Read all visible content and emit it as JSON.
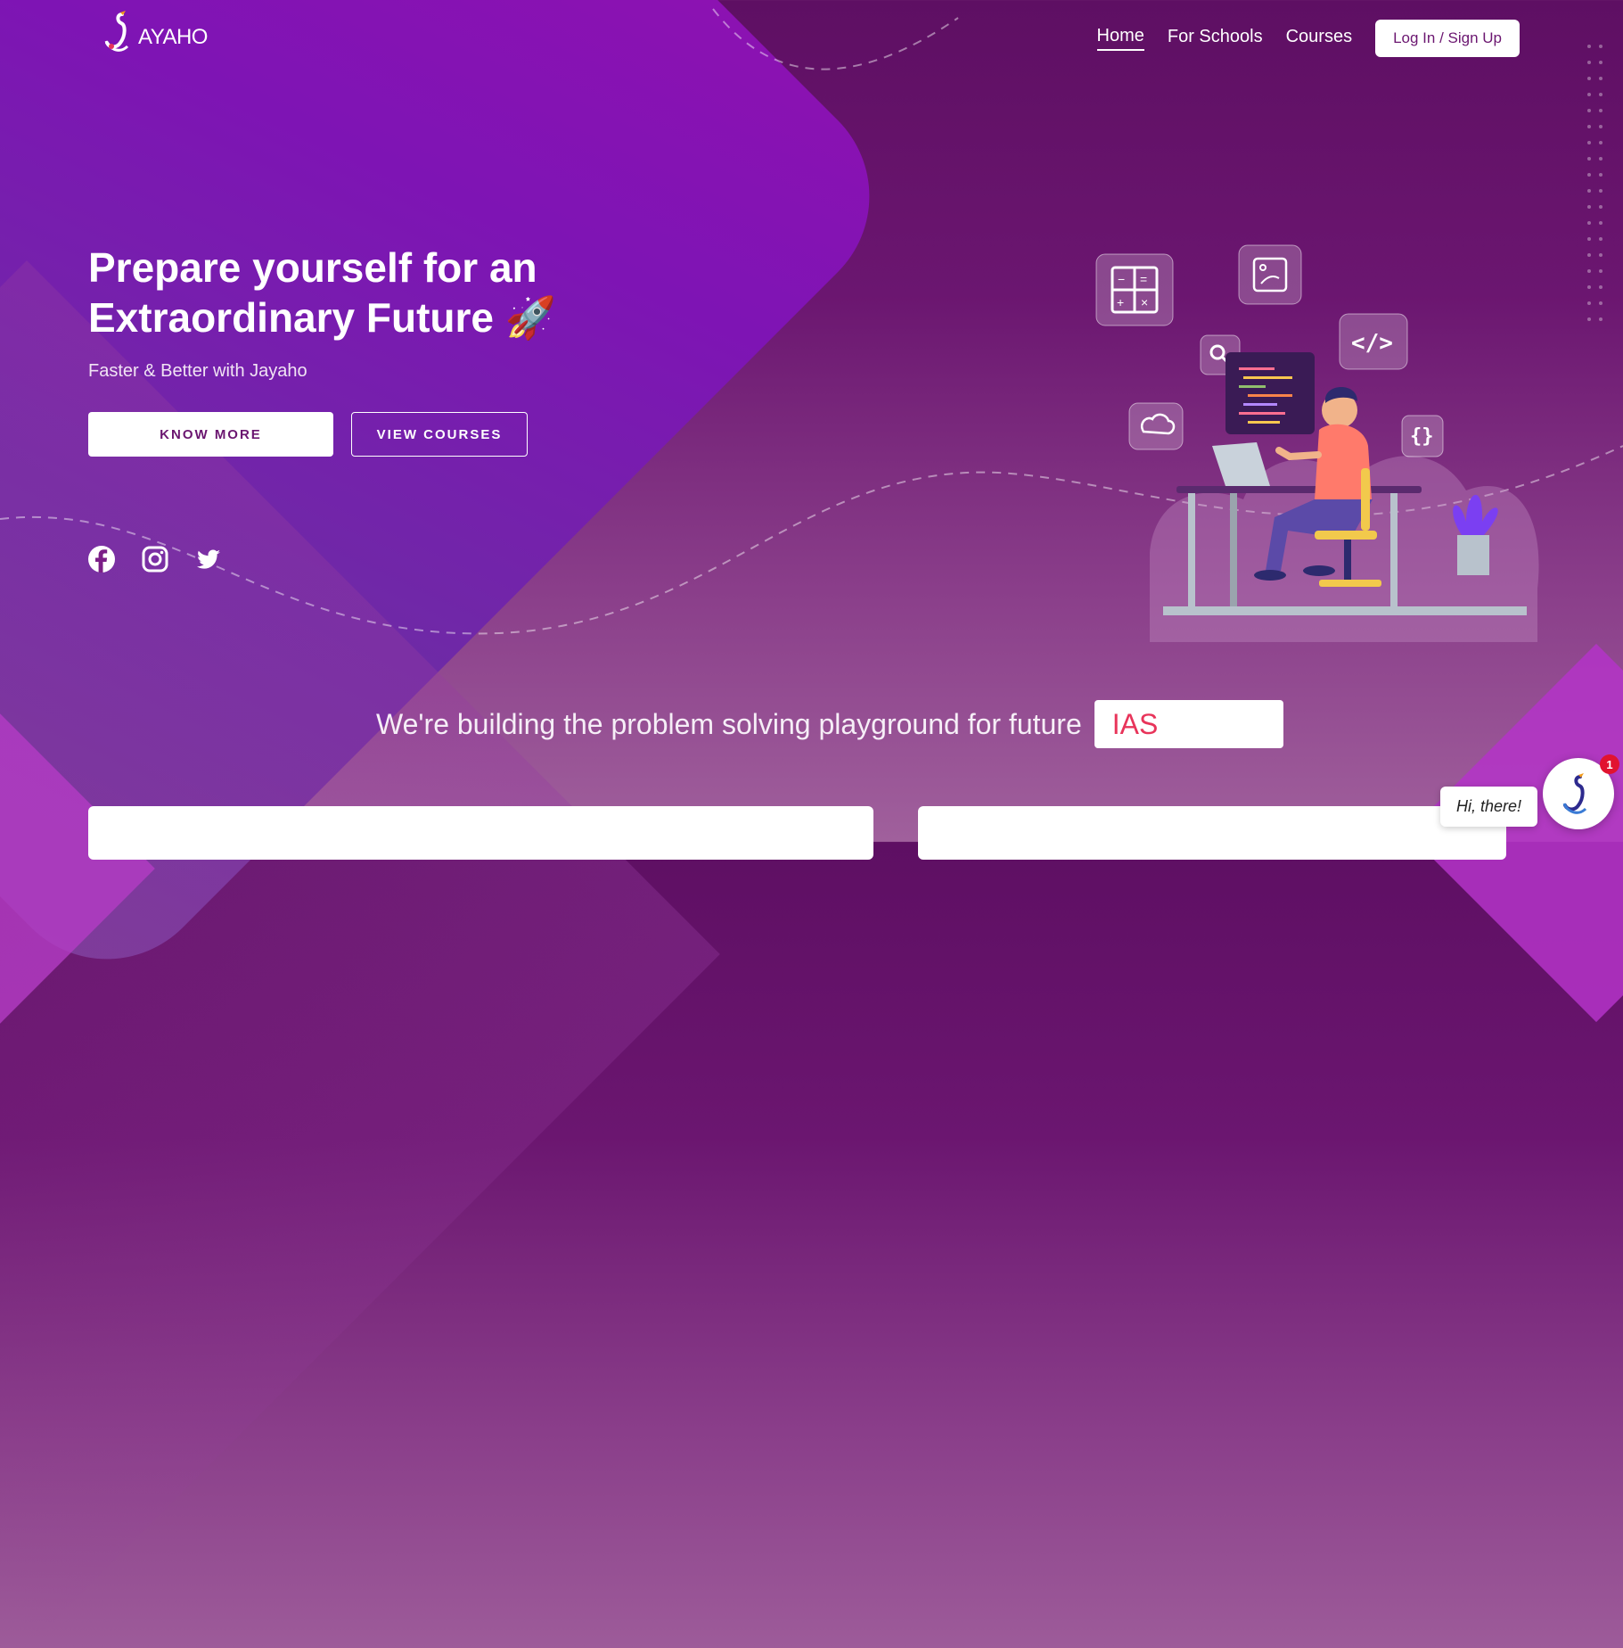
{
  "brand": {
    "logo_text": "AYAHO",
    "accent": "#6b1670",
    "highlight": "#e8345a"
  },
  "nav": {
    "links": [
      "Home",
      "For Schools",
      "Courses"
    ],
    "active": "Home",
    "login_label": "Log In / Sign Up"
  },
  "hero": {
    "title_line1": "Prepare yourself for an",
    "title_line2": "Extraordinary Future 🚀",
    "subtitle": "Faster & Better with Jayaho",
    "know_more_label": "KNOW MORE",
    "view_courses_label": "VIEW COURSES",
    "social_icons": [
      "facebook-icon",
      "instagram-icon",
      "twitter-icon"
    ]
  },
  "tagline": {
    "text": "We're building the problem solving playground for future",
    "rotating_word": "IAS"
  },
  "chat": {
    "greeting": "Hi, there!",
    "unread_count": "1"
  }
}
